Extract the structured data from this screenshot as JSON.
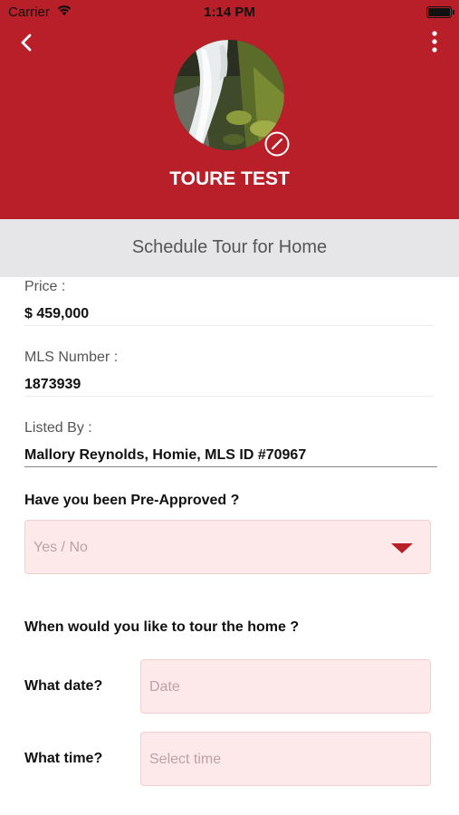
{
  "status_bar": {
    "carrier": "Carrier",
    "time": "1:14 PM"
  },
  "header": {
    "name": "TOURE TEST",
    "background_color": "#b81f28"
  },
  "banner": {
    "title": "Schedule Tour for Home"
  },
  "details": {
    "price_label": "Price :",
    "price_value": "$ 459,000",
    "mls_label": "MLS Number :",
    "mls_value": "1873939",
    "listed_by_label": "Listed By :",
    "listed_by_value": "Mallory Reynolds, Homie, MLS ID #70967"
  },
  "form": {
    "preapproved_question": "Have you been Pre-Approved ?",
    "preapproved_placeholder": "Yes / No",
    "tour_question": "When would you like to tour the home ?",
    "date_label": "What date?",
    "date_placeholder": "Date",
    "time_label": "What time?",
    "time_placeholder": "Select time",
    "field_color": "#fde9e9"
  },
  "icons": {
    "back": "chevron-left-icon",
    "more": "more-vertical-icon",
    "edit": "no-edit-icon",
    "wifi": "wifi-icon",
    "battery": "battery-icon"
  }
}
